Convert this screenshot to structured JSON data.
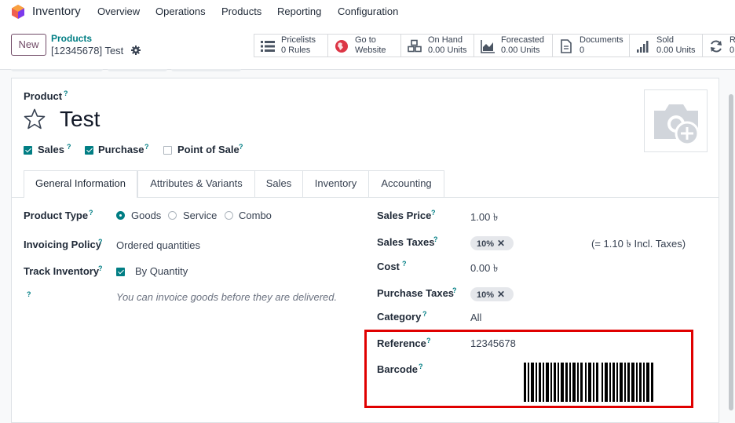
{
  "app": {
    "title": "Inventory"
  },
  "nav": [
    "Overview",
    "Operations",
    "Products",
    "Reporting",
    "Configuration"
  ],
  "control": {
    "new_label": "New",
    "breadcrumb_parent": "Products",
    "breadcrumb_current": "[12345678] Test"
  },
  "smart_buttons": [
    {
      "l1": "Pricelists",
      "l2": "0 Rules",
      "icon": "list-icon"
    },
    {
      "l1": "Go to",
      "l2": "Website",
      "icon": "globe-icon"
    },
    {
      "l1": "On Hand",
      "l2": "0.00 Units",
      "icon": "cubes-icon"
    },
    {
      "l1": "Forecasted",
      "l2": "0.00 Units",
      "icon": "area-chart-icon"
    },
    {
      "l1": "Documents",
      "l2": "0",
      "icon": "document-icon"
    },
    {
      "l1": "Sold",
      "l2": "0.00 Units",
      "icon": "signal-icon"
    },
    {
      "l1": "Re",
      "l2": "0",
      "icon": "refresh-icon"
    }
  ],
  "product": {
    "label": "Product",
    "name": "Test",
    "help": "?",
    "flags": [
      {
        "label": "Sales",
        "checked": true
      },
      {
        "label": "Purchase",
        "checked": true
      },
      {
        "label": "Point of Sale",
        "checked": false
      }
    ]
  },
  "tabs": [
    "General Information",
    "Attributes & Variants",
    "Sales",
    "Inventory",
    "Accounting"
  ],
  "left": {
    "product_type_label": "Product Type",
    "product_type_options": [
      "Goods",
      "Service",
      "Combo"
    ],
    "product_type_selected": "Goods",
    "invoicing_label": "Invoicing Policy",
    "invoicing_value": "Ordered quantities",
    "track_label": "Track Inventory",
    "track_value": "By Quantity",
    "note": "You can invoice goods before they are delivered."
  },
  "right": {
    "sales_price_label": "Sales Price",
    "sales_price_value": "1.00 ৳",
    "sales_taxes_label": "Sales Taxes",
    "sales_taxes_tag": "10%",
    "sales_taxes_incl": "(= 1.10 ৳ Incl. Taxes)",
    "cost_label": "Cost",
    "cost_value": "0.00 ৳",
    "purchase_taxes_label": "Purchase Taxes",
    "purchase_taxes_tag": "10%",
    "category_label": "Category",
    "category_value": "All",
    "reference_label": "Reference",
    "reference_value": "12345678",
    "barcode_label": "Barcode"
  },
  "colors": {
    "accent": "#017e84",
    "brand": "#714b67",
    "highlight": "#e00000"
  }
}
